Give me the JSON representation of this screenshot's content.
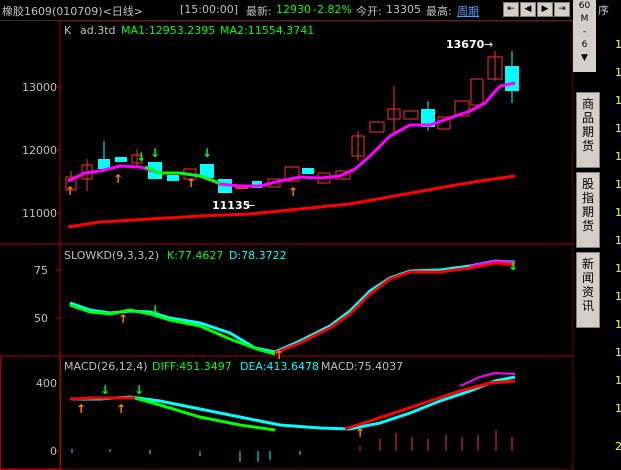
{
  "header": {
    "instrument": "橡胶1609",
    "code_period": "(010709)<日线>",
    "time": "[15:00:00]",
    "latest_label": "最新:",
    "latest_value": "12930",
    "change_pct": "-2.82%",
    "open_label": "今开:",
    "open_value": "13305",
    "high_label": "最高:",
    "period_link": "周期"
  },
  "main_chart": {
    "k_label": "K",
    "name": "ad.3td",
    "ma1": "MA1:12953.2395",
    "ma2": "MA2:11554.3741",
    "high_annot": "13670",
    "low_annot": "11135",
    "y_ticks": [
      "13000",
      "12000",
      "11000"
    ]
  },
  "kd_panel": {
    "title": "SLOWKD(9,3,3,2)",
    "k": "K:77.4627",
    "d": "D:78.3722",
    "y_ticks": [
      "75",
      "50"
    ]
  },
  "macd_panel": {
    "title": "MACD(26,12,4)",
    "diff": "DIFF:451.3497",
    "dea": "DEA:413.6478",
    "macd": "MACD:75.4037",
    "y_ticks": [
      "400",
      "0"
    ]
  },
  "right_panel": {
    "zoom_lines": [
      "60",
      "M",
      "-",
      "6",
      "▼"
    ],
    "tabs": [
      "商品期货",
      "股指期货",
      "新闻资讯"
    ],
    "column_header": "序",
    "column_digits": [
      "1",
      "1",
      "1",
      "1",
      "1",
      "1",
      "1",
      "1",
      "1",
      "1",
      "1",
      "1",
      "1",
      "1",
      "2"
    ]
  },
  "colors": {
    "up": "#ff3030",
    "down": "#00ffff",
    "ma1": "#ff00ff",
    "ma2": "#ff0000",
    "green": "#00ff00",
    "latest": "#00ff00",
    "axis": "#b00000"
  }
}
